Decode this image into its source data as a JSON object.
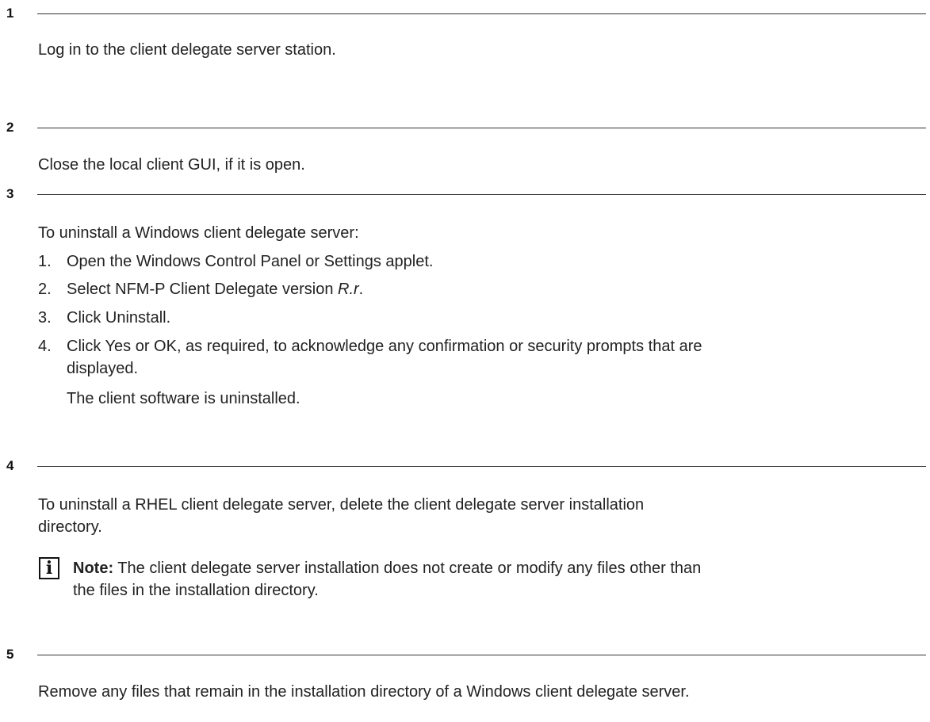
{
  "steps": [
    {
      "number": "1",
      "text": "Log in to the client delegate server station."
    },
    {
      "number": "2",
      "text": "Close the local client GUI, if it is open."
    },
    {
      "number": "3",
      "text": "To uninstall a Windows client delegate server:",
      "substeps": [
        {
          "num": "1.",
          "text": "Open the Windows Control Panel or Settings applet."
        },
        {
          "num": "2.",
          "text": "Select NFM-P Client Delegate version ",
          "italic": "R.r",
          "suffix": "."
        },
        {
          "num": "3.",
          "text": "Click Uninstall."
        },
        {
          "num": "4.",
          "text_line1": "Click Yes or OK, as required, to acknowledge any confirmation or security prompts that are",
          "text_line2": "displayed."
        }
      ],
      "result": "The client software is uninstalled."
    },
    {
      "number": "4",
      "text_line1": "To uninstall a RHEL client delegate server, delete the client delegate server installation",
      "text_line2": "directory.",
      "note": {
        "icon": "info-icon",
        "label": "Note:",
        "text_line1": " The client delegate server installation does not create or modify any files other than",
        "text_line2": "the files in the installation directory."
      }
    },
    {
      "number": "5",
      "text": "Remove any files that remain in the installation directory of a Windows client delegate server."
    }
  ]
}
